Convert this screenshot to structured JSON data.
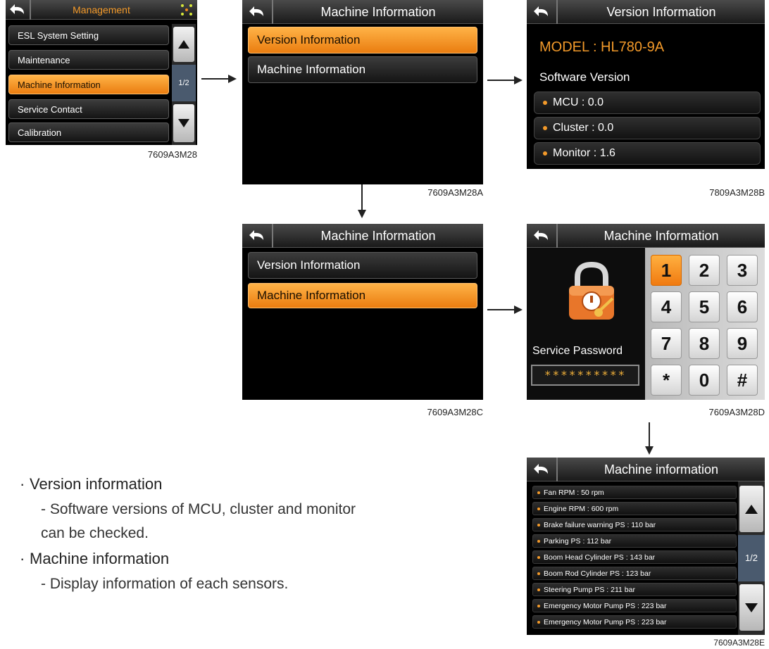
{
  "screen1": {
    "title": "Management",
    "items": [
      "ESL System Setting",
      "Maintenance",
      "Machine Information",
      "Service Contact",
      "Calibration"
    ],
    "selected_index": 2,
    "page": "1/2",
    "caption": "7609A3M28"
  },
  "screen2": {
    "title": "Machine Information",
    "items": [
      "Version Information",
      "Machine Information"
    ],
    "selected_index": 0,
    "caption": "7609A3M28A"
  },
  "screen3": {
    "title": "Version Information",
    "model": "MODEL : HL780-9A",
    "software_label": "Software Version",
    "rows": [
      "MCU : 0.0",
      "Cluster : 0.0",
      "Monitor : 1.6"
    ],
    "caption": "7809A3M28B"
  },
  "screen4": {
    "title": "Machine Information",
    "items": [
      "Version Information",
      "Machine Information"
    ],
    "selected_index": 1,
    "caption": "7609A3M28C"
  },
  "screen5": {
    "title": "Machine Information",
    "password_label": "Service Password",
    "password_value": "**********",
    "keys": [
      "1",
      "2",
      "3",
      "4",
      "5",
      "6",
      "7",
      "8",
      "9",
      "*",
      "0",
      "#"
    ],
    "selected_key": "1",
    "caption": "7609A3M28D"
  },
  "screen6": {
    "title": "Machine information",
    "rows": [
      "Fan RPM : 50 rpm",
      "Engine RPM : 600 rpm",
      "Brake failure warning PS : 110 bar",
      "Parking PS : 112 bar",
      "Boom Head Cylinder PS : 143 bar",
      "Boom Rod Cylinder PS : 123 bar",
      "Steering Pump PS : 211 bar",
      "Emergency Motor Pump PS : 223 bar",
      "Emergency Motor Pump PS : 223 bar"
    ],
    "page": "1/2",
    "caption": "7609A3M28E"
  },
  "notes": [
    {
      "heading": "Version information",
      "body": "- Software versions of MCU, cluster and monitor can be checked."
    },
    {
      "heading": "Machine information",
      "body": "- Display information of each sensors."
    }
  ],
  "colors": {
    "accent": "#f08a1c",
    "screen_bg": "#000000"
  },
  "icons": [
    "back-arrow-icon",
    "lock-icon",
    "up-arrow-icon",
    "down-arrow-icon",
    "grid-dots-icon"
  ]
}
